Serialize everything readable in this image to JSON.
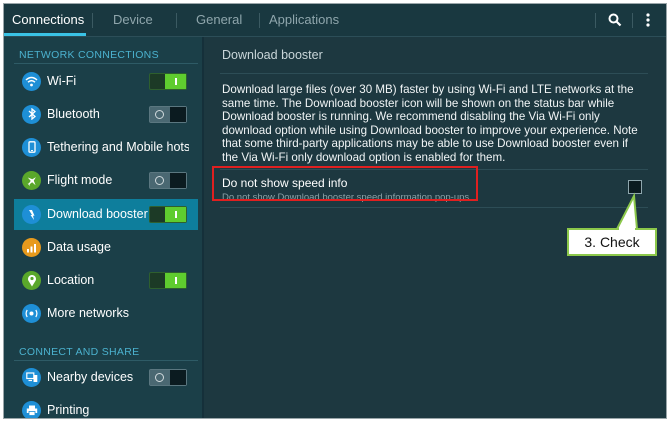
{
  "tabs": [
    {
      "label": "Connections",
      "active": true
    },
    {
      "label": "Device",
      "active": false
    },
    {
      "label": "General",
      "active": false
    },
    {
      "label": "Applications",
      "active": false
    }
  ],
  "toolbar": {
    "search_icon": "search-icon",
    "menu_icon": "more-vert-icon"
  },
  "sidebar": {
    "section1": "NETWORK CONNECTIONS",
    "section2": "CONNECT AND SHARE",
    "items": [
      {
        "label": "Wi-Fi",
        "icon": "wifi-icon",
        "toggle": "on"
      },
      {
        "label": "Bluetooth",
        "icon": "bluetooth-icon",
        "toggle": "off"
      },
      {
        "label": "Tethering and Mobile hots...",
        "icon": "tethering-icon",
        "toggle": null
      },
      {
        "label": "Flight mode",
        "icon": "airplane-icon",
        "toggle": "off"
      },
      {
        "label": "Download booster",
        "icon": "download-booster-icon",
        "toggle": "on",
        "selected": true
      },
      {
        "label": "Data usage",
        "icon": "data-usage-icon",
        "toggle": null
      },
      {
        "label": "Location",
        "icon": "location-icon",
        "toggle": "on"
      },
      {
        "label": "More networks",
        "icon": "more-networks-icon",
        "toggle": null
      },
      {
        "label": "Nearby devices",
        "icon": "nearby-devices-icon",
        "toggle": "off"
      },
      {
        "label": "Printing",
        "icon": "printer-icon",
        "toggle": null
      }
    ]
  },
  "main": {
    "title": "Download booster",
    "description": "Download large files (over 30 MB) faster by using Wi-Fi and LTE networks at the same time. The Download booster icon will be shown on the status bar while Download booster is running. We recommend disabling the Via Wi-Fi only download option while using Download booster to improve your experience. Note that some third-party applications may be able to use Download booster even if the Via Wi-Fi only download option is enabled for them.",
    "option_title": "Do not show speed info",
    "option_subtitle": "Do not show Download booster speed information pop-ups.",
    "option_checked": false
  },
  "callout": {
    "label": "3. Check"
  },
  "colors": {
    "accent": "#3ac3e6",
    "selected_row": "#0e7e9c",
    "toggle_on": "#5fcc2f",
    "highlight": "#e02020",
    "callout_border": "#8cc84b"
  }
}
